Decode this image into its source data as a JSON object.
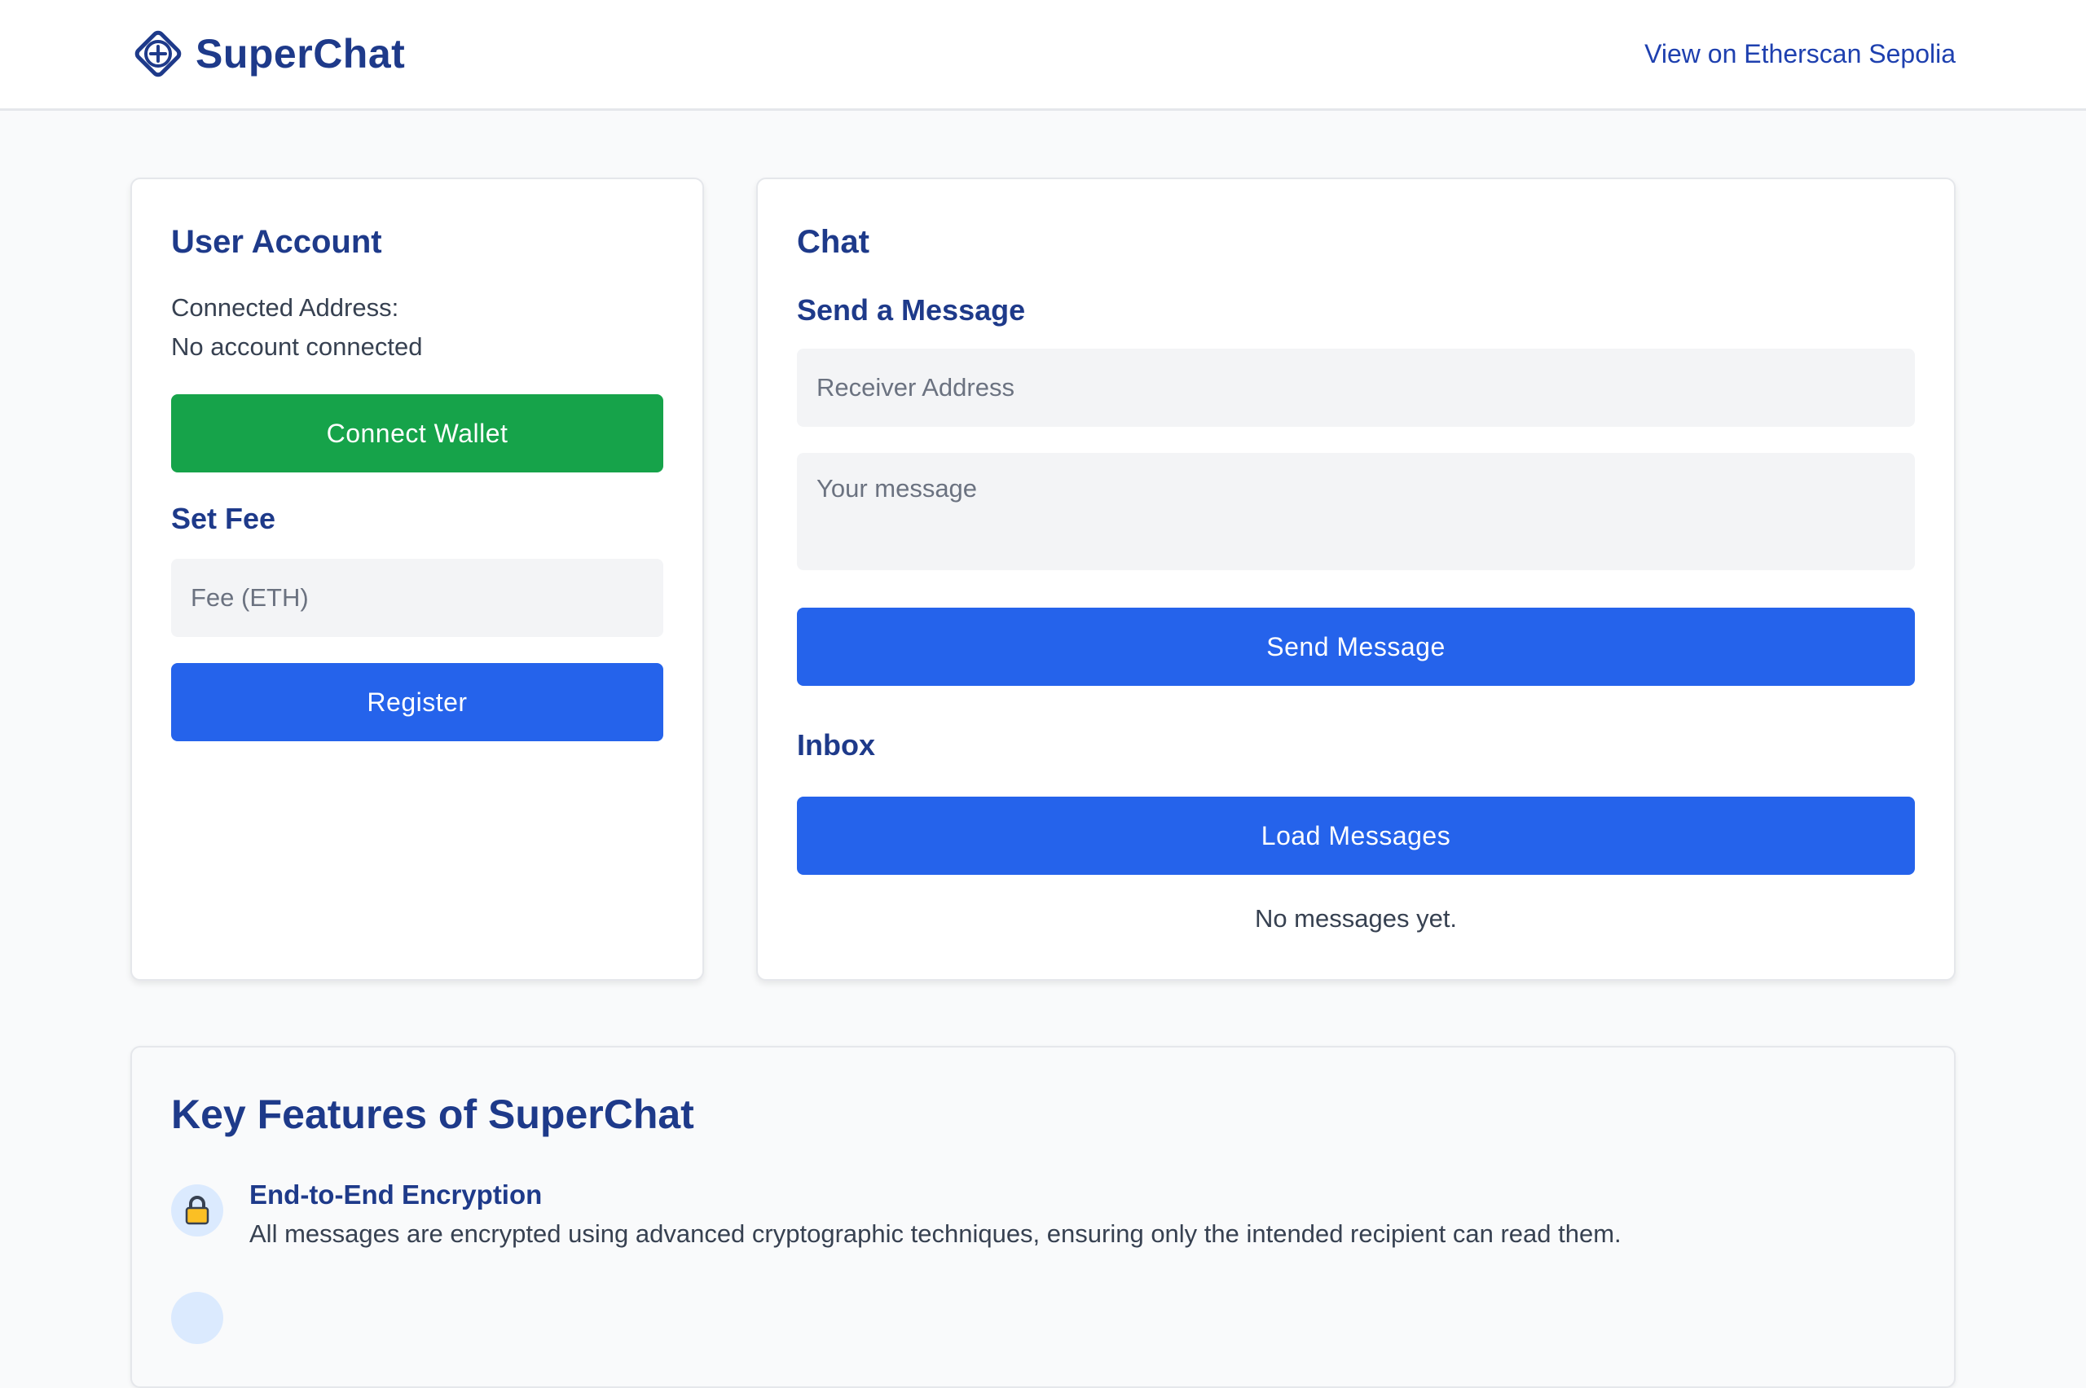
{
  "header": {
    "brand_name": "SuperChat",
    "brand_icon": "plus-diamond-icon",
    "etherscan_link": "View on Etherscan Sepolia"
  },
  "account": {
    "title": "User Account",
    "connected_label": "Connected Address:",
    "connected_value": "No account connected",
    "connect_button": "Connect Wallet",
    "fee_title": "Set Fee",
    "fee_placeholder": "Fee (ETH)",
    "register_button": "Register"
  },
  "chat": {
    "title": "Chat",
    "send_title": "Send a Message",
    "receiver_placeholder": "Receiver Address",
    "message_placeholder": "Your message",
    "send_button": "Send Message",
    "inbox_title": "Inbox",
    "load_button": "Load Messages",
    "empty_text": "No messages yet."
  },
  "features": {
    "title": "Key Features of SuperChat",
    "items": [
      {
        "icon": "lock-icon",
        "title": "End-to-End Encryption",
        "description": "All messages are encrypted using advanced cryptographic techniques, ensuring only the intended recipient can read them."
      }
    ]
  },
  "colors": {
    "primary": "#2563eb",
    "success": "#16a34a",
    "heading": "#1e3a8a",
    "input_bg": "#f3f4f6"
  }
}
